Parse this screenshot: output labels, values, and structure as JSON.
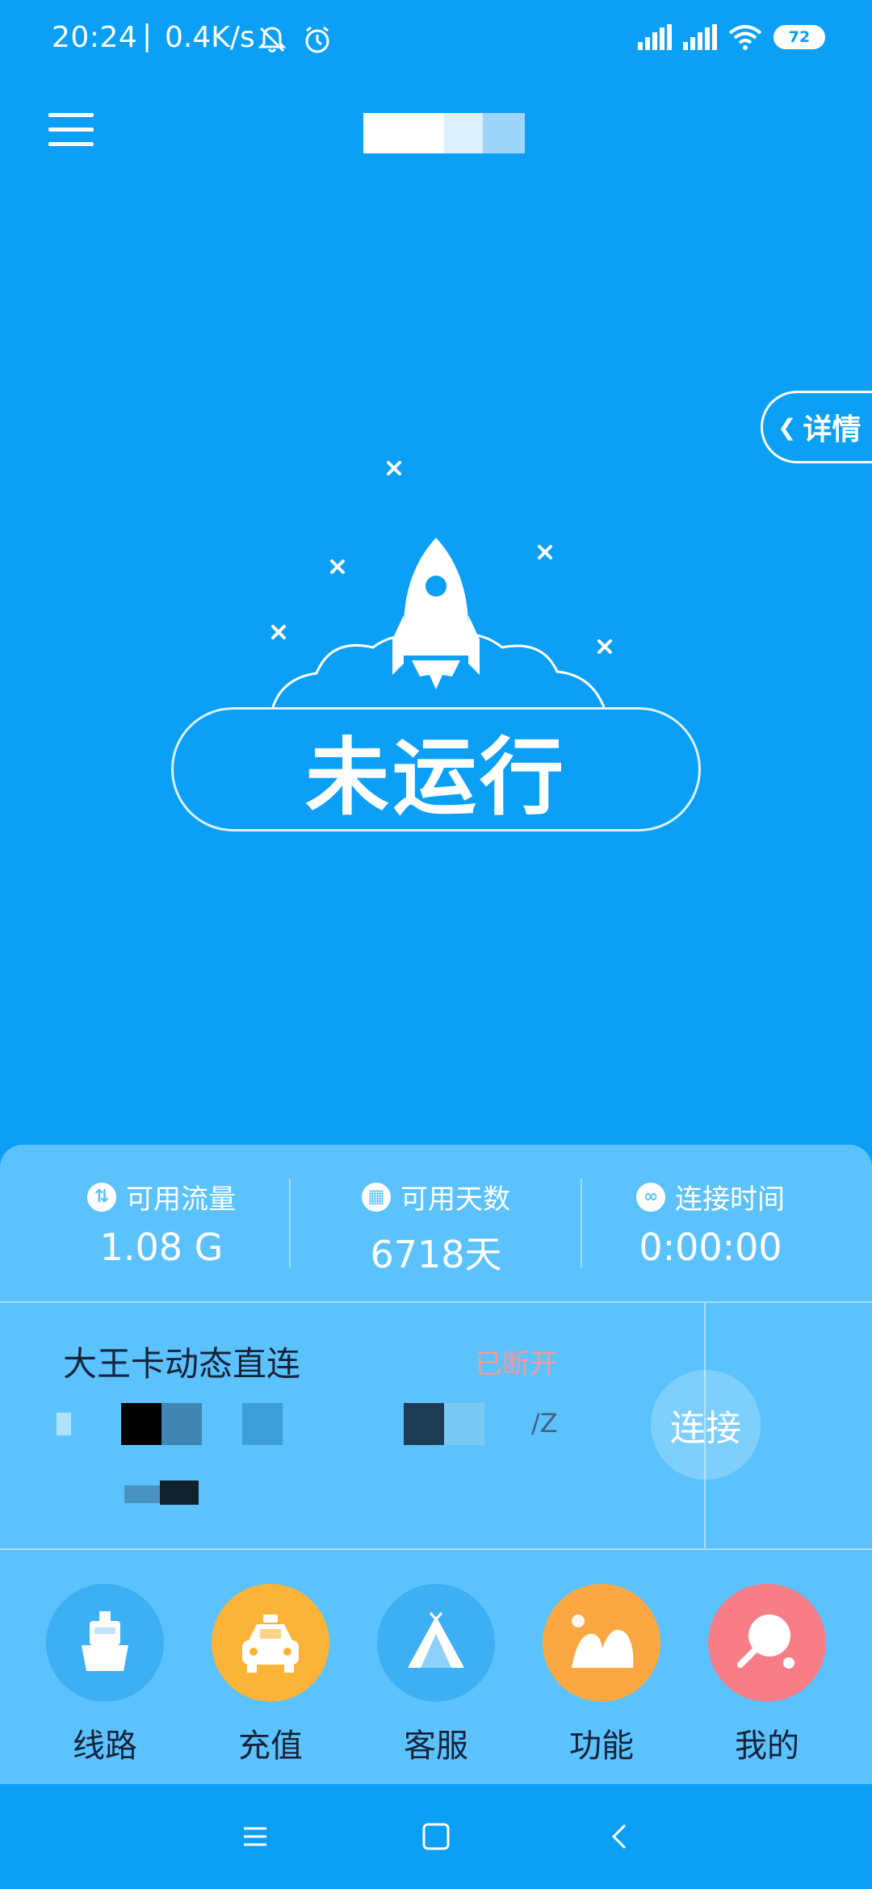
{
  "status_bar": {
    "time": "20:24",
    "separator": "|",
    "net_speed": "0.4K/s",
    "battery": "72",
    "icons": [
      "mute-icon",
      "alarm-icon",
      "signal-icon",
      "signal-icon",
      "wifi-icon",
      "battery-icon"
    ]
  },
  "header": {
    "menu_icon": "hamburger-menu-icon"
  },
  "details_tab": {
    "label": "详情",
    "arrow": "❮"
  },
  "hero": {
    "status_text": "未运行",
    "colors": {
      "background": "#0B9FF5",
      "outline": "#FFFFFF"
    }
  },
  "stats": [
    {
      "icon": "traffic-icon",
      "glyph": "⇅",
      "label": "可用流量",
      "value": "1.08 G"
    },
    {
      "icon": "calendar-icon",
      "glyph": "▦",
      "label": "可用天数",
      "value": "6718天"
    },
    {
      "icon": "link-icon",
      "glyph": "∞",
      "label": "连接时间",
      "value": "0:00:00"
    }
  ],
  "line": {
    "name": "大王卡动态直连",
    "state": "已断开",
    "info_suffix": "/Z",
    "connect_label": "连接"
  },
  "nav": [
    {
      "label": "线路",
      "icon": "ship-icon",
      "color": "#3DAFF3"
    },
    {
      "label": "充值",
      "icon": "taxi-icon",
      "color": "#FBB437"
    },
    {
      "label": "客服",
      "icon": "tent-icon",
      "color": "#3DAFF3"
    },
    {
      "label": "功能",
      "icon": "mountain-icon",
      "color": "#FBA842"
    },
    {
      "label": "我的",
      "icon": "ping-pong-icon",
      "color": "#F77D86"
    }
  ],
  "system_nav": {
    "icons": [
      "recent-apps-icon",
      "home-icon",
      "back-icon"
    ]
  }
}
